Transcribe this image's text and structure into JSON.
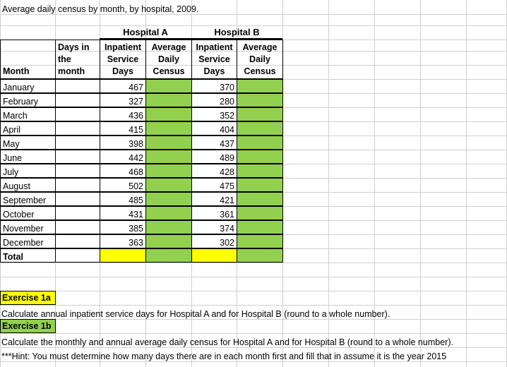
{
  "sheet": {
    "title": "Average daily census by month, by hospital, 2009.",
    "colors": {
      "green_fill": "#92D050",
      "yellow_fill": "#FFFF00",
      "gridline": "#D0D0D0",
      "border": "#000000"
    }
  },
  "table": {
    "group_headers": [
      {
        "label": "Hospital A"
      },
      {
        "label": "Hospital B"
      }
    ],
    "column_headers": [
      "Month",
      "Days in the month",
      "Inpatient Service Days",
      "Average Daily Census",
      "Inpatient Service Days",
      "Average Daily Census"
    ],
    "rows": [
      {
        "month": "January",
        "days": "",
        "a_isd": "467",
        "a_adc": "",
        "b_isd": "370",
        "b_adc": ""
      },
      {
        "month": "February",
        "days": "",
        "a_isd": "327",
        "a_adc": "",
        "b_isd": "280",
        "b_adc": ""
      },
      {
        "month": "March",
        "days": "",
        "a_isd": "436",
        "a_adc": "",
        "b_isd": "352",
        "b_adc": ""
      },
      {
        "month": "April",
        "days": "",
        "a_isd": "415",
        "a_adc": "",
        "b_isd": "404",
        "b_adc": ""
      },
      {
        "month": "May",
        "days": "",
        "a_isd": "398",
        "a_adc": "",
        "b_isd": "437",
        "b_adc": ""
      },
      {
        "month": "June",
        "days": "",
        "a_isd": "442",
        "a_adc": "",
        "b_isd": "489",
        "b_adc": ""
      },
      {
        "month": "July",
        "days": "",
        "a_isd": "468",
        "a_adc": "",
        "b_isd": "428",
        "b_adc": ""
      },
      {
        "month": "August",
        "days": "",
        "a_isd": "502",
        "a_adc": "",
        "b_isd": "475",
        "b_adc": ""
      },
      {
        "month": "September",
        "days": "",
        "a_isd": "485",
        "a_adc": "",
        "b_isd": "421",
        "b_adc": ""
      },
      {
        "month": "October",
        "days": "",
        "a_isd": "431",
        "a_adc": "",
        "b_isd": "361",
        "b_adc": ""
      },
      {
        "month": "November",
        "days": "",
        "a_isd": "385",
        "a_adc": "",
        "b_isd": "374",
        "b_adc": ""
      },
      {
        "month": "December",
        "days": "",
        "a_isd": "363",
        "a_adc": "",
        "b_isd": "302",
        "b_adc": ""
      }
    ],
    "total_row": {
      "label": "Total",
      "days": "",
      "a_isd": "",
      "a_adc": "",
      "b_isd": "",
      "b_adc": ""
    }
  },
  "exercises": [
    {
      "tag": "Exercise 1a",
      "tag_fill": "yellow",
      "lines": [
        "Calculate annual inpatient service days for Hospital A and for Hospital B (round to a whole number)."
      ]
    },
    {
      "tag": "Exercise 1b",
      "tag_fill": "green",
      "lines": [
        "Calculate the monthly and annual average daily census for Hospital A and for Hospital B (round to a whole number).",
        "***Hint:  You must determine how many days there are in each month first and fill that in assume it is the year 2015"
      ]
    }
  ]
}
